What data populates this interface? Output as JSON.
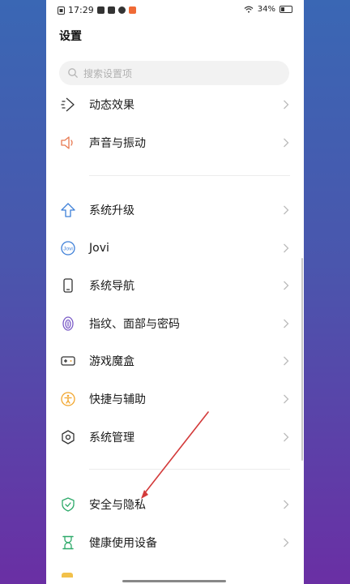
{
  "status_bar": {
    "time": "17:29",
    "battery_percent": "34%",
    "battery_level": 0.34
  },
  "header": {
    "title": "设置"
  },
  "search": {
    "placeholder": "搜索设置项"
  },
  "items": [
    {
      "label": "动态效果",
      "icon": "motion-effects-icon"
    },
    {
      "label": "声音与振动",
      "icon": "speaker-icon",
      "color": "#e87a52"
    },
    {
      "label": "系统升级",
      "icon": "upgrade-arrow-icon",
      "color": "#3d7fd8"
    },
    {
      "label": "Jovi",
      "icon": "jovi-icon",
      "color": "#3d7fd8"
    },
    {
      "label": "系统导航",
      "icon": "phone-icon"
    },
    {
      "label": "指纹、面部与密码",
      "icon": "fingerprint-icon",
      "color": "#7a5bc7"
    },
    {
      "label": "游戏魔盒",
      "icon": "gamepad-icon"
    },
    {
      "label": "快捷与辅助",
      "icon": "accessibility-icon",
      "color": "#f2a52b"
    },
    {
      "label": "系统管理",
      "icon": "gear-hex-icon"
    },
    {
      "label": "安全与隐私",
      "icon": "shield-check-icon",
      "color": "#2eaa6a"
    },
    {
      "label": "健康使用设备",
      "icon": "hourglass-icon",
      "color": "#2eaa6a"
    }
  ],
  "colors": {
    "accent_blue": "#3d7fd8",
    "annotation_arrow": "#d33a3a"
  }
}
